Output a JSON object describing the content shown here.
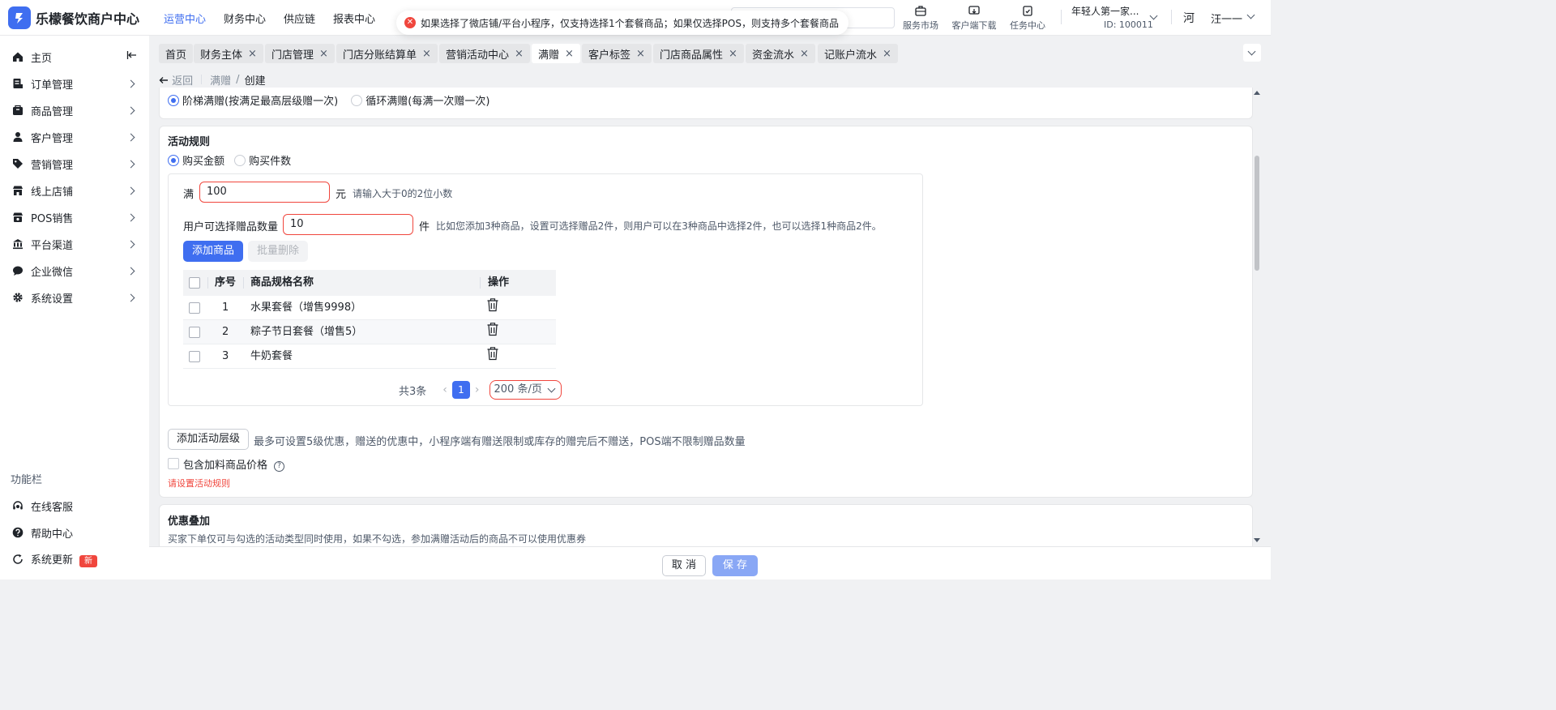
{
  "app": {
    "brand_name": "乐檬餐饮商户中心",
    "colors": {
      "accent": "#3f6ef0",
      "danger": "#f0463d",
      "text": "#1f2329",
      "muted": "#86909c"
    }
  },
  "top_nav": {
    "items": [
      {
        "label": "运营中心",
        "active": true
      },
      {
        "label": "财务中心",
        "active": false
      },
      {
        "label": "供应链",
        "active": false
      },
      {
        "label": "报表中心",
        "active": false
      }
    ]
  },
  "toast": {
    "icon": "error-circle-icon",
    "message": "如果选择了微店铺/平台小程序，仅支持选择1个套餐商品；如果仅选择POS，则支持多个套餐商品"
  },
  "header_tools": [
    {
      "label": "服务市场",
      "icon": "briefcase-icon"
    },
    {
      "label": "客户端下载",
      "icon": "download-icon"
    },
    {
      "label": "任务中心",
      "icon": "task-icon"
    }
  ],
  "account": {
    "shop_name": "年轻人第一家...",
    "shop_id": "ID: 100011",
    "avatar_text": "河",
    "user_name": "汪一一"
  },
  "sidebar": {
    "items": [
      {
        "label": "主页",
        "icon": "home-icon"
      },
      {
        "label": "订单管理",
        "icon": "order-icon"
      },
      {
        "label": "商品管理",
        "icon": "goods-icon"
      },
      {
        "label": "客户管理",
        "icon": "user-icon"
      },
      {
        "label": "营销管理",
        "icon": "tag-icon"
      },
      {
        "label": "线上店铺",
        "icon": "store-icon"
      },
      {
        "label": "POS销售",
        "icon": "pos-icon"
      },
      {
        "label": "平台渠道",
        "icon": "bank-icon"
      },
      {
        "label": "企业微信",
        "icon": "chat-icon"
      },
      {
        "label": "系统设置",
        "icon": "gear-icon"
      }
    ],
    "section_title": "功能栏",
    "bottom_items": [
      {
        "label": "在线客服",
        "icon": "headset-icon"
      },
      {
        "label": "帮助中心",
        "icon": "help-icon"
      },
      {
        "label": "系统更新",
        "icon": "refresh-icon",
        "badge": "新"
      }
    ]
  },
  "tabs": [
    {
      "label": "首页",
      "closable": false,
      "active": false
    },
    {
      "label": "财务主体",
      "closable": true,
      "active": false
    },
    {
      "label": "门店管理",
      "closable": true,
      "active": false
    },
    {
      "label": "门店分账结算单",
      "closable": true,
      "active": false
    },
    {
      "label": "营销活动中心",
      "closable": true,
      "active": false
    },
    {
      "label": "满赠",
      "closable": true,
      "active": true
    },
    {
      "label": "客户标签",
      "closable": true,
      "active": false
    },
    {
      "label": "门店商品属性",
      "closable": true,
      "active": false
    },
    {
      "label": "资金流水",
      "closable": true,
      "active": false
    },
    {
      "label": "记账户流水",
      "closable": true,
      "active": false
    }
  ],
  "close_glyph": "×",
  "breadcrumb": {
    "back": "返回",
    "parent": "满赠",
    "sep": "/",
    "current": "创建"
  },
  "gift_mode": {
    "options": [
      {
        "label": "阶梯满赠(按满足最高层级赠一次)",
        "checked": true
      },
      {
        "label": "循环满赠(每满一次赠一次)",
        "checked": false
      }
    ]
  },
  "rules": {
    "title": "活动规则",
    "basis_options": [
      {
        "label": "购买金额",
        "checked": true
      },
      {
        "label": "购买件数",
        "checked": false
      }
    ],
    "threshold": {
      "prefix": "满",
      "value": "100",
      "unit": "元",
      "hint": "请输入大于0的2位小数"
    },
    "gift_qty": {
      "label": "用户可选择赠品数量",
      "value": "10",
      "unit": "件",
      "hint": "比如您添加3种商品，设置可选择赠品2件，则用户可以在3种商品中选择2件，也可以选择1种商品2件。"
    },
    "add_goods_button": "添加商品",
    "batch_delete_button": "批量删除",
    "table": {
      "columns": [
        "序号",
        "商品规格名称",
        "操作"
      ],
      "rows": [
        {
          "index": "1",
          "name": "水果套餐（增售9998）"
        },
        {
          "index": "2",
          "name": "粽子节日套餐（增售5）"
        },
        {
          "index": "3",
          "name": "牛奶套餐"
        }
      ]
    },
    "pagination": {
      "total": "共3条",
      "prev": "‹",
      "page": "1",
      "next": "›",
      "page_size": "200 条/页"
    },
    "add_level_button": "添加活动层级",
    "add_level_hint": "最多可设置5级优惠，赠送的优惠中，小程序端有赠送限制或库存的赠完后不赠送，POS端不限制赠品数量",
    "include_addon_label": "包含加料商品价格",
    "help_glyph": "?",
    "error": "请设置活动规则"
  },
  "stacking": {
    "title": "优惠叠加",
    "desc": "买家下单仅可与勾选的活动类型同时使用，如果不勾选，参加满赠活动后的商品不可以使用优惠券"
  },
  "footer": {
    "cancel": "取 消",
    "save": "保 存"
  }
}
